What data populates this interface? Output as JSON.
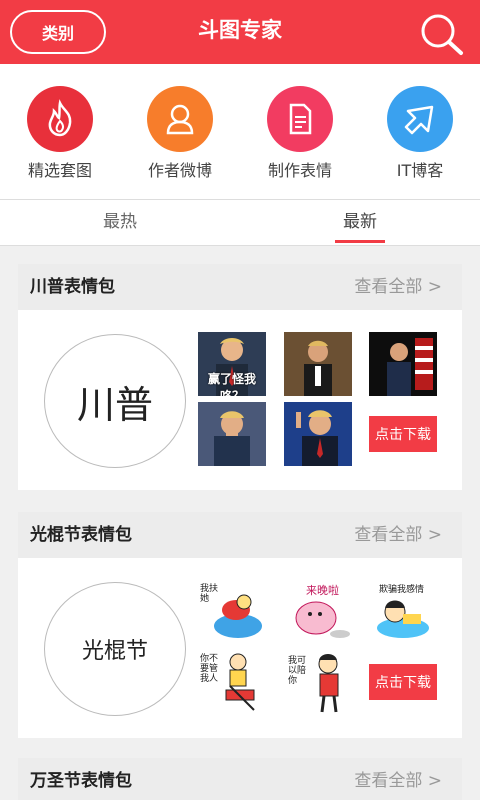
{
  "header": {
    "category_button": "类别",
    "title": "斗图专家"
  },
  "quick_links": [
    {
      "label": "精选套图",
      "icon": "flame-icon",
      "color": "#e8303b"
    },
    {
      "label": "作者微博",
      "icon": "person-icon",
      "color": "#f77d2b"
    },
    {
      "label": "制作表情",
      "icon": "document-icon",
      "color": "#f23c61"
    },
    {
      "label": "IT博客",
      "icon": "arrow-icon",
      "color": "#3aa1ef"
    }
  ],
  "tabs": [
    {
      "label": "最热",
      "active": false
    },
    {
      "label": "最新",
      "active": true
    }
  ],
  "packs": [
    {
      "title": "川普表情包",
      "view_all": "查看全部 >",
      "cover_text": "川普",
      "thumb_captions": [
        "赢了怪我咯？"
      ],
      "download": "点击下载"
    },
    {
      "title": "光棍节表情包",
      "view_all": "查看全部 >",
      "cover_text": "光棍节",
      "thumb_captions": [
        "我扶她",
        "来晚啦",
        "欺骗我感情",
        "你不要管我人",
        "我可以陪你"
      ],
      "download": "点击下载"
    },
    {
      "title": "万圣节表情包",
      "view_all": "查看全部 >"
    }
  ]
}
